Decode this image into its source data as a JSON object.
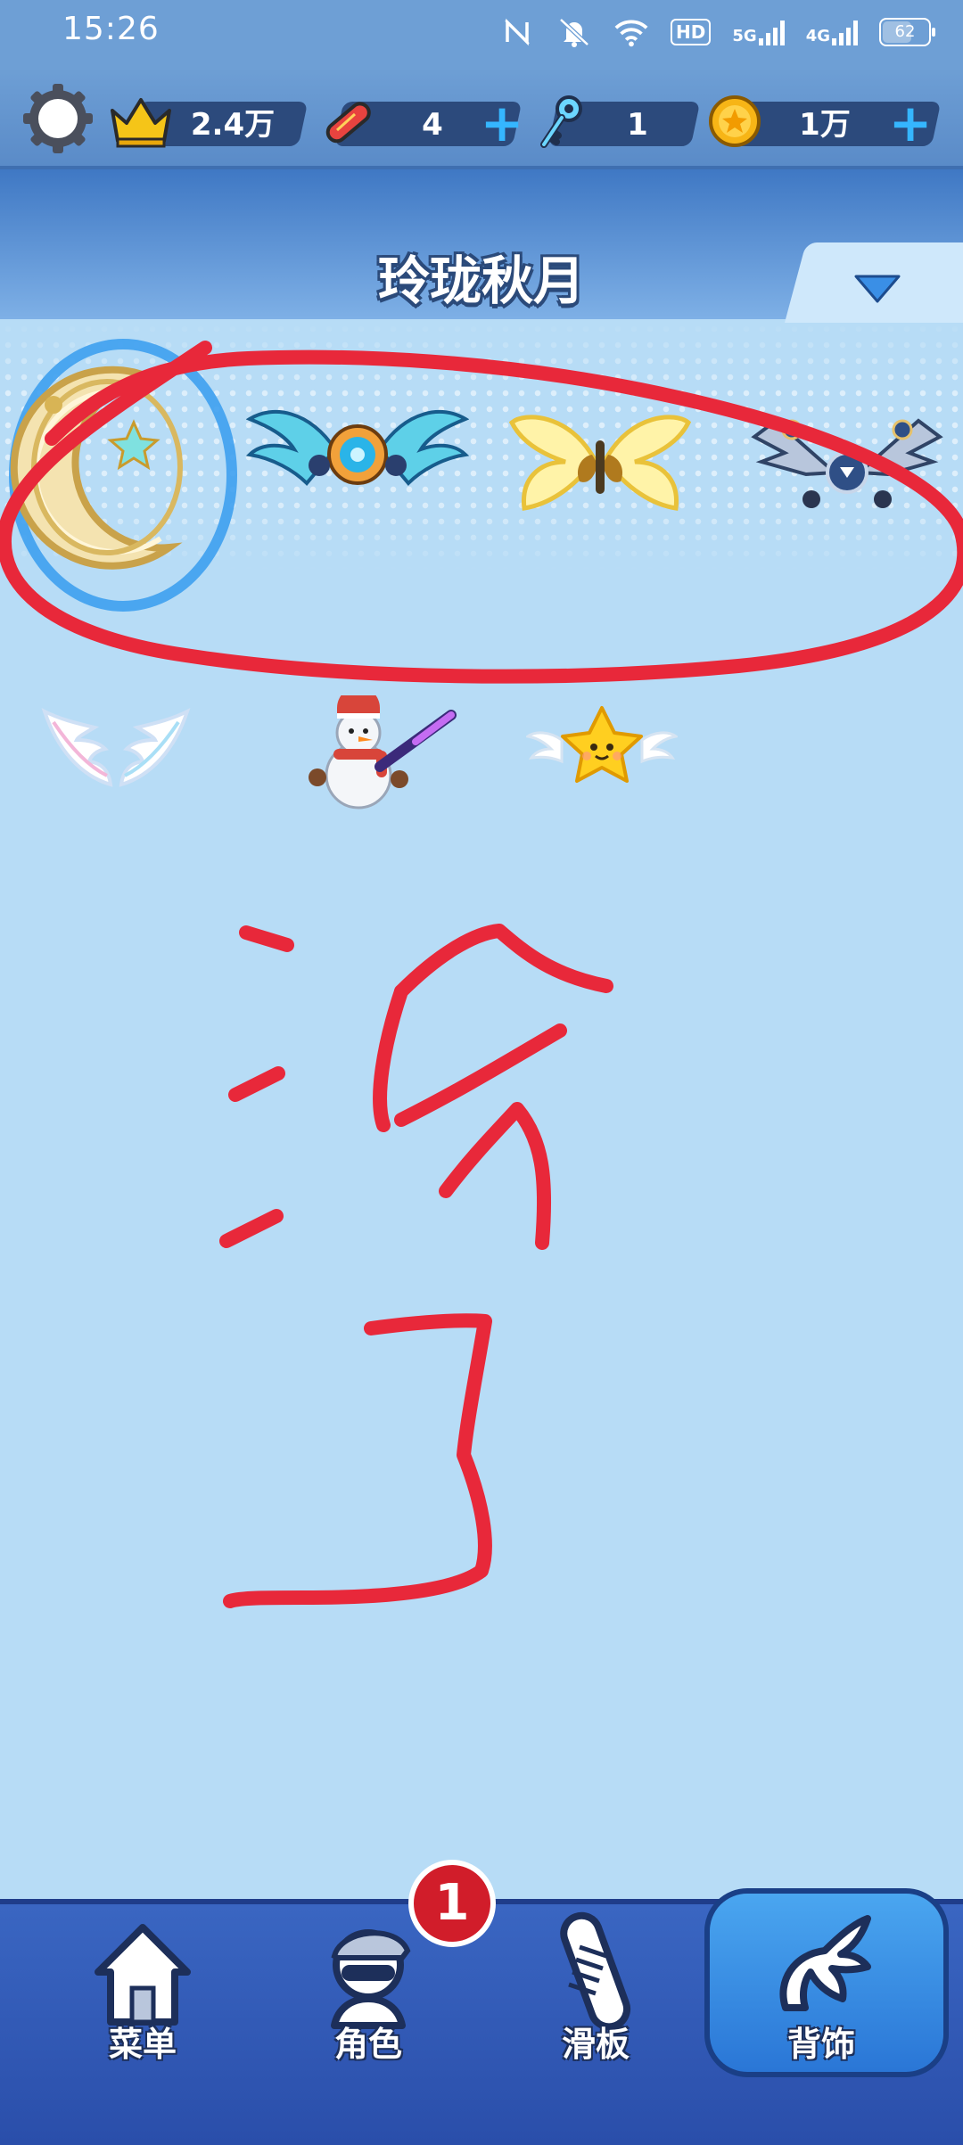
{
  "status_bar": {
    "time": "15:26",
    "icons": [
      "nfc-icon",
      "mute-bell-icon",
      "wifi-icon",
      "hd-voice-icon",
      "5g-signal-icon",
      "4g-signal-icon",
      "battery-icon"
    ],
    "hd_label": "HD",
    "net_5g": "5G",
    "net_4g": "4G",
    "battery": "62"
  },
  "resources": {
    "crowns": "2.4万",
    "boards": "4",
    "keys": "1",
    "coins": "1万"
  },
  "page": {
    "title": "玲珑秋月"
  },
  "items": {
    "row1": [
      "moon-ring-backpack",
      "mecha-cyan-wings",
      "golden-butterfly-wings",
      "mecha-silver-wings"
    ],
    "row2": [
      "angel-wings",
      "snowman-backpack",
      "flying-star"
    ]
  },
  "annotation": {
    "color": "#e8283a",
    "text": "没了"
  },
  "nav": {
    "menu": "菜单",
    "role": "角色",
    "board": "滑板",
    "back": "背饰",
    "active": "背饰",
    "role_badge": "1"
  },
  "colors": {
    "status_bg": "#6e9fd5",
    "page_bg": "#b7dcf6",
    "nav_bg": "#3a66c2",
    "accent": "#35b6ff"
  }
}
